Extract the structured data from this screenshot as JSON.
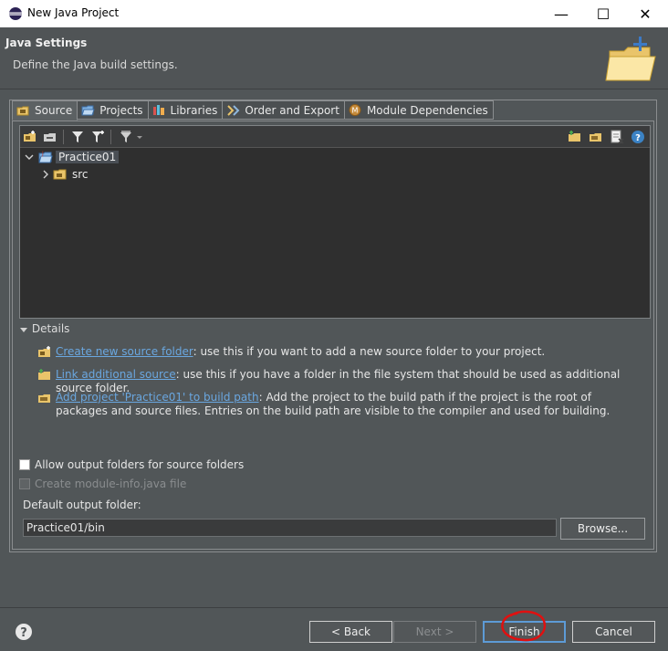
{
  "window": {
    "title": "New Java Project",
    "minimize_glyph": "—",
    "maximize_glyph": "☐",
    "close_glyph": "✕"
  },
  "header": {
    "title": "Java Settings",
    "description": "Define the Java build settings."
  },
  "tabs": [
    {
      "label": "Source",
      "icon": "source-icon",
      "active": true
    },
    {
      "label": "Projects",
      "icon": "projects-icon",
      "active": false
    },
    {
      "label": "Libraries",
      "icon": "libraries-icon",
      "active": false
    },
    {
      "label": "Order and Export",
      "icon": "order-export-icon",
      "active": false
    },
    {
      "label": "Module Dependencies",
      "icon": "module-icon",
      "active": false
    }
  ],
  "tree": {
    "project": "Practice01",
    "folder": "src"
  },
  "details": {
    "heading": "Details",
    "rows": [
      {
        "link": "Create new source folder",
        "text": ": use this if you want to add a new source folder to your project."
      },
      {
        "link": "Link additional source",
        "text": ": use this if you have a folder in the file system that should be used as additional source folder."
      },
      {
        "link": "Add project 'Practice01' to build path",
        "text": ": Add the project to the build path if the project is the root of packages and source files. Entries on the build path are visible to the compiler and used for building."
      }
    ]
  },
  "options": {
    "allow_output": "Allow output folders for source folders",
    "create_module_info": "Create module-info.java file"
  },
  "output": {
    "label": "Default output folder:",
    "value": "Practice01/bin",
    "browse": "Browse..."
  },
  "buttons": {
    "back": "< Back",
    "next": "Next >",
    "finish": "Finish",
    "cancel": "Cancel"
  },
  "colors": {
    "link": "#6aa7e0",
    "default_button_border": "#5d9bd6",
    "annotation": "#e01010"
  }
}
